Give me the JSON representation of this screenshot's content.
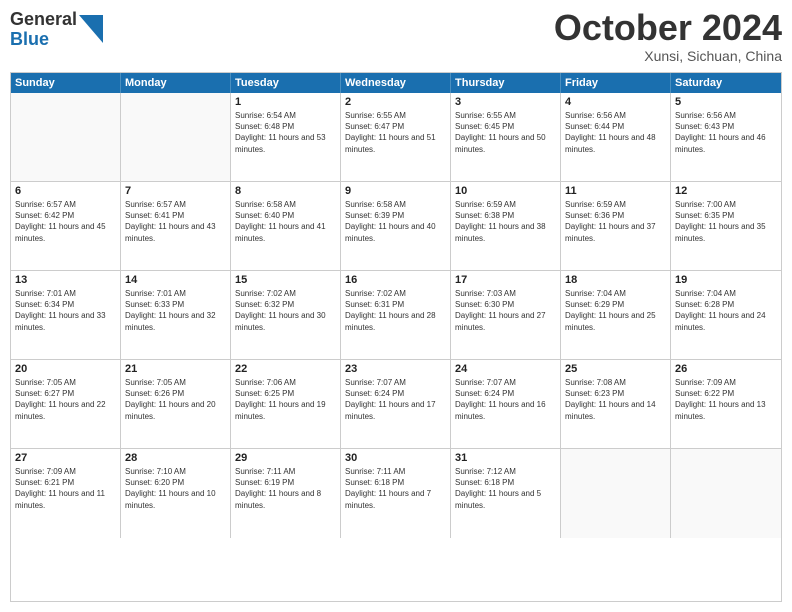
{
  "header": {
    "logo_general": "General",
    "logo_blue": "Blue",
    "title": "October 2024",
    "location": "Xunsi, Sichuan, China"
  },
  "days_of_week": [
    "Sunday",
    "Monday",
    "Tuesday",
    "Wednesday",
    "Thursday",
    "Friday",
    "Saturday"
  ],
  "weeks": [
    [
      {
        "day": "",
        "sunrise": "",
        "sunset": "",
        "daylight": "",
        "empty": true
      },
      {
        "day": "",
        "sunrise": "",
        "sunset": "",
        "daylight": "",
        "empty": true
      },
      {
        "day": "1",
        "sunrise": "Sunrise: 6:54 AM",
        "sunset": "Sunset: 6:48 PM",
        "daylight": "Daylight: 11 hours and 53 minutes.",
        "empty": false
      },
      {
        "day": "2",
        "sunrise": "Sunrise: 6:55 AM",
        "sunset": "Sunset: 6:47 PM",
        "daylight": "Daylight: 11 hours and 51 minutes.",
        "empty": false
      },
      {
        "day": "3",
        "sunrise": "Sunrise: 6:55 AM",
        "sunset": "Sunset: 6:45 PM",
        "daylight": "Daylight: 11 hours and 50 minutes.",
        "empty": false
      },
      {
        "day": "4",
        "sunrise": "Sunrise: 6:56 AM",
        "sunset": "Sunset: 6:44 PM",
        "daylight": "Daylight: 11 hours and 48 minutes.",
        "empty": false
      },
      {
        "day": "5",
        "sunrise": "Sunrise: 6:56 AM",
        "sunset": "Sunset: 6:43 PM",
        "daylight": "Daylight: 11 hours and 46 minutes.",
        "empty": false
      }
    ],
    [
      {
        "day": "6",
        "sunrise": "Sunrise: 6:57 AM",
        "sunset": "Sunset: 6:42 PM",
        "daylight": "Daylight: 11 hours and 45 minutes.",
        "empty": false
      },
      {
        "day": "7",
        "sunrise": "Sunrise: 6:57 AM",
        "sunset": "Sunset: 6:41 PM",
        "daylight": "Daylight: 11 hours and 43 minutes.",
        "empty": false
      },
      {
        "day": "8",
        "sunrise": "Sunrise: 6:58 AM",
        "sunset": "Sunset: 6:40 PM",
        "daylight": "Daylight: 11 hours and 41 minutes.",
        "empty": false
      },
      {
        "day": "9",
        "sunrise": "Sunrise: 6:58 AM",
        "sunset": "Sunset: 6:39 PM",
        "daylight": "Daylight: 11 hours and 40 minutes.",
        "empty": false
      },
      {
        "day": "10",
        "sunrise": "Sunrise: 6:59 AM",
        "sunset": "Sunset: 6:38 PM",
        "daylight": "Daylight: 11 hours and 38 minutes.",
        "empty": false
      },
      {
        "day": "11",
        "sunrise": "Sunrise: 6:59 AM",
        "sunset": "Sunset: 6:36 PM",
        "daylight": "Daylight: 11 hours and 37 minutes.",
        "empty": false
      },
      {
        "day": "12",
        "sunrise": "Sunrise: 7:00 AM",
        "sunset": "Sunset: 6:35 PM",
        "daylight": "Daylight: 11 hours and 35 minutes.",
        "empty": false
      }
    ],
    [
      {
        "day": "13",
        "sunrise": "Sunrise: 7:01 AM",
        "sunset": "Sunset: 6:34 PM",
        "daylight": "Daylight: 11 hours and 33 minutes.",
        "empty": false
      },
      {
        "day": "14",
        "sunrise": "Sunrise: 7:01 AM",
        "sunset": "Sunset: 6:33 PM",
        "daylight": "Daylight: 11 hours and 32 minutes.",
        "empty": false
      },
      {
        "day": "15",
        "sunrise": "Sunrise: 7:02 AM",
        "sunset": "Sunset: 6:32 PM",
        "daylight": "Daylight: 11 hours and 30 minutes.",
        "empty": false
      },
      {
        "day": "16",
        "sunrise": "Sunrise: 7:02 AM",
        "sunset": "Sunset: 6:31 PM",
        "daylight": "Daylight: 11 hours and 28 minutes.",
        "empty": false
      },
      {
        "day": "17",
        "sunrise": "Sunrise: 7:03 AM",
        "sunset": "Sunset: 6:30 PM",
        "daylight": "Daylight: 11 hours and 27 minutes.",
        "empty": false
      },
      {
        "day": "18",
        "sunrise": "Sunrise: 7:04 AM",
        "sunset": "Sunset: 6:29 PM",
        "daylight": "Daylight: 11 hours and 25 minutes.",
        "empty": false
      },
      {
        "day": "19",
        "sunrise": "Sunrise: 7:04 AM",
        "sunset": "Sunset: 6:28 PM",
        "daylight": "Daylight: 11 hours and 24 minutes.",
        "empty": false
      }
    ],
    [
      {
        "day": "20",
        "sunrise": "Sunrise: 7:05 AM",
        "sunset": "Sunset: 6:27 PM",
        "daylight": "Daylight: 11 hours and 22 minutes.",
        "empty": false
      },
      {
        "day": "21",
        "sunrise": "Sunrise: 7:05 AM",
        "sunset": "Sunset: 6:26 PM",
        "daylight": "Daylight: 11 hours and 20 minutes.",
        "empty": false
      },
      {
        "day": "22",
        "sunrise": "Sunrise: 7:06 AM",
        "sunset": "Sunset: 6:25 PM",
        "daylight": "Daylight: 11 hours and 19 minutes.",
        "empty": false
      },
      {
        "day": "23",
        "sunrise": "Sunrise: 7:07 AM",
        "sunset": "Sunset: 6:24 PM",
        "daylight": "Daylight: 11 hours and 17 minutes.",
        "empty": false
      },
      {
        "day": "24",
        "sunrise": "Sunrise: 7:07 AM",
        "sunset": "Sunset: 6:24 PM",
        "daylight": "Daylight: 11 hours and 16 minutes.",
        "empty": false
      },
      {
        "day": "25",
        "sunrise": "Sunrise: 7:08 AM",
        "sunset": "Sunset: 6:23 PM",
        "daylight": "Daylight: 11 hours and 14 minutes.",
        "empty": false
      },
      {
        "day": "26",
        "sunrise": "Sunrise: 7:09 AM",
        "sunset": "Sunset: 6:22 PM",
        "daylight": "Daylight: 11 hours and 13 minutes.",
        "empty": false
      }
    ],
    [
      {
        "day": "27",
        "sunrise": "Sunrise: 7:09 AM",
        "sunset": "Sunset: 6:21 PM",
        "daylight": "Daylight: 11 hours and 11 minutes.",
        "empty": false
      },
      {
        "day": "28",
        "sunrise": "Sunrise: 7:10 AM",
        "sunset": "Sunset: 6:20 PM",
        "daylight": "Daylight: 11 hours and 10 minutes.",
        "empty": false
      },
      {
        "day": "29",
        "sunrise": "Sunrise: 7:11 AM",
        "sunset": "Sunset: 6:19 PM",
        "daylight": "Daylight: 11 hours and 8 minutes.",
        "empty": false
      },
      {
        "day": "30",
        "sunrise": "Sunrise: 7:11 AM",
        "sunset": "Sunset: 6:18 PM",
        "daylight": "Daylight: 11 hours and 7 minutes.",
        "empty": false
      },
      {
        "day": "31",
        "sunrise": "Sunrise: 7:12 AM",
        "sunset": "Sunset: 6:18 PM",
        "daylight": "Daylight: 11 hours and 5 minutes.",
        "empty": false
      },
      {
        "day": "",
        "sunrise": "",
        "sunset": "",
        "daylight": "",
        "empty": true
      },
      {
        "day": "",
        "sunrise": "",
        "sunset": "",
        "daylight": "",
        "empty": true
      }
    ]
  ]
}
